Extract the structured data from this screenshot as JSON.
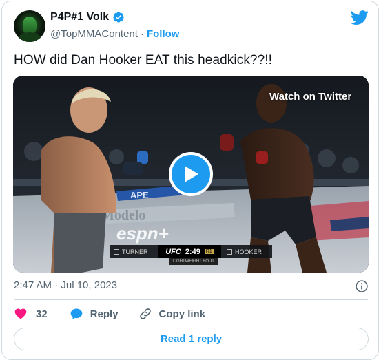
{
  "author": {
    "display_name": "P4P#1 Volk",
    "handle": "@TopMMAContent",
    "separator": "·",
    "follow_label": "Follow",
    "verified": true
  },
  "icons": {
    "brand": "twitter-bird-icon",
    "verified": "verified-badge-icon",
    "play": "play-icon",
    "info": "info-icon",
    "like": "heart-icon",
    "reply": "speech-bubble-icon",
    "copy": "link-icon"
  },
  "colors": {
    "accent": "#1d9bf0",
    "like": "#f91880",
    "text_primary": "#0f1419",
    "text_secondary": "#536471",
    "border": "#cfd9de"
  },
  "tweet": {
    "text": "HOW did Dan Hooker EAT this headkick??!!",
    "timestamp": "2:47 AM · Jul 10, 2023"
  },
  "media": {
    "watch_label": "Watch on Twitter",
    "scoreboard": {
      "fighter_left": "TURNER",
      "fighter_right": "HOOKER",
      "brand": "UFC",
      "clock": "2:49",
      "round": "R1",
      "division": "LIGHTWEIGHT BOUT"
    },
    "banner_texts": [
      "APE",
      "Modelo",
      "espn+"
    ]
  },
  "actions": {
    "like_count": "32",
    "reply_label": "Reply",
    "copy_label": "Copy link"
  },
  "read_replies_label": "Read 1 reply"
}
